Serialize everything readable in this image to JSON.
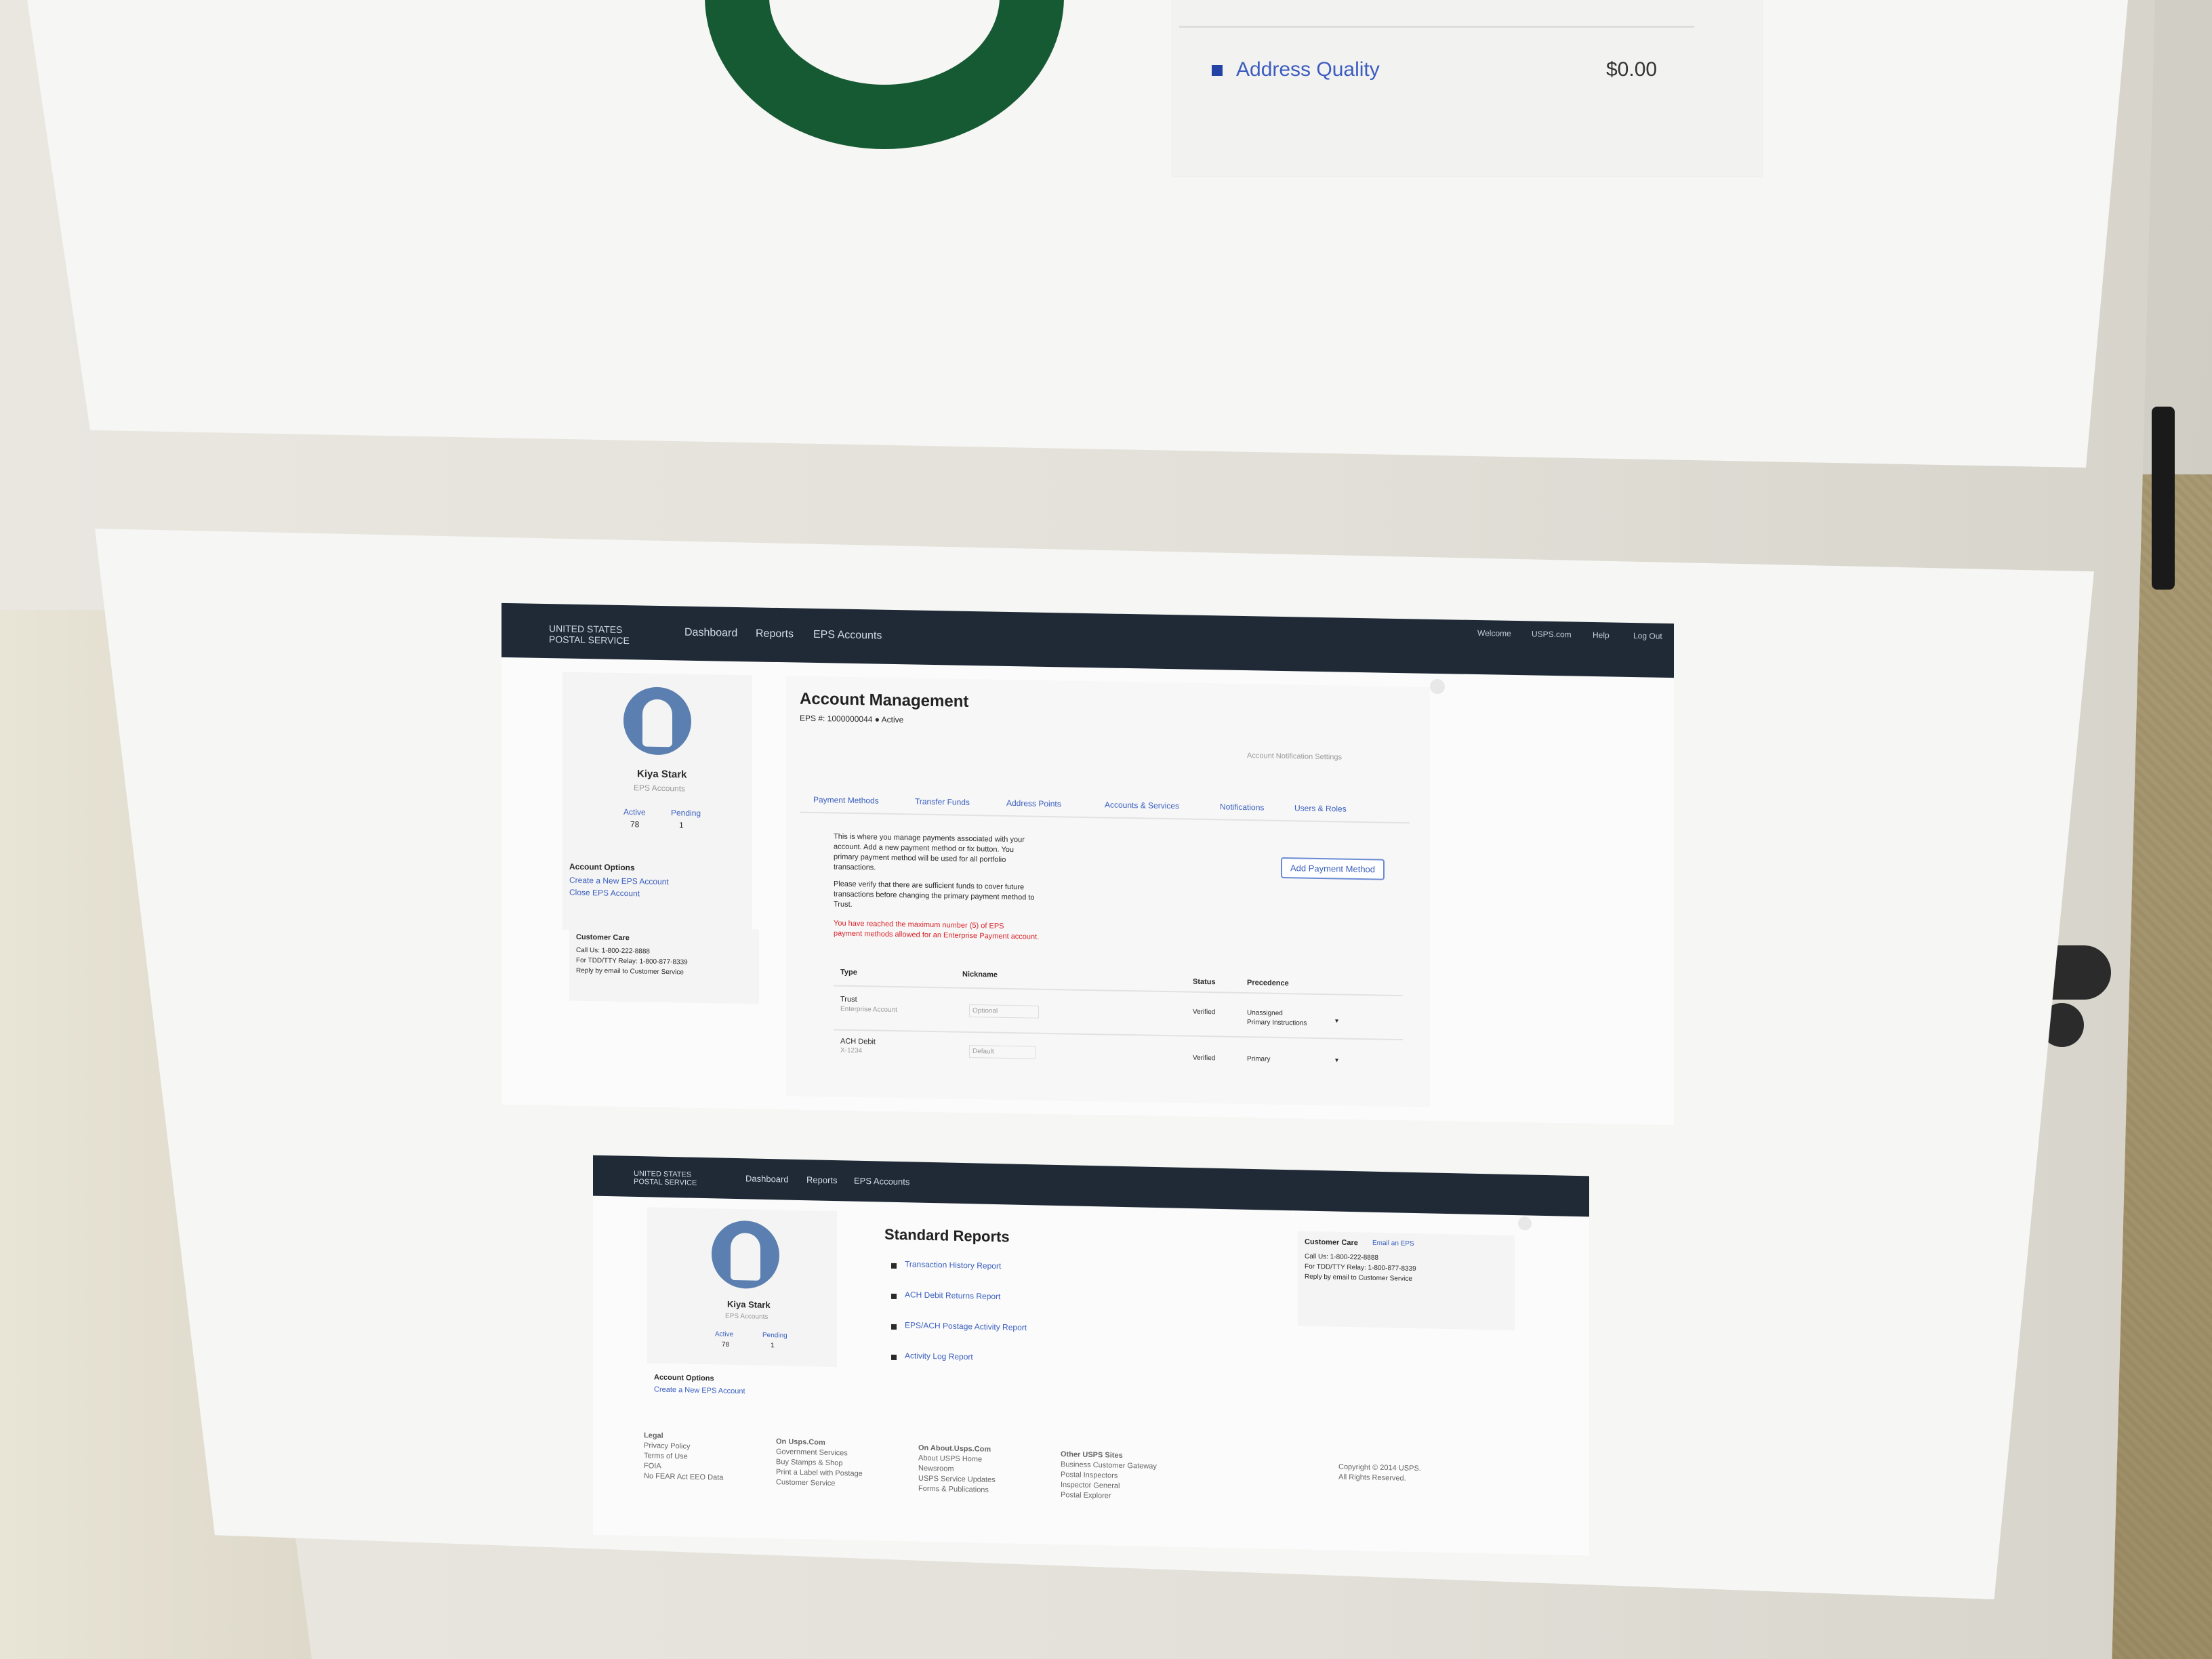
{
  "top_sheet": {
    "legend": [
      {
        "label": "Address Quality",
        "value": "$0.00",
        "color": "#2443a5"
      }
    ],
    "donut_color": "#155a32"
  },
  "printout_account": {
    "nav": {
      "logo": "UNITED STATES POSTAL SERVICE",
      "items": [
        "Dashboard",
        "Reports",
        "EPS Accounts"
      ],
      "right": [
        "Welcome",
        "USPS.com",
        "Help",
        "Log Out"
      ]
    },
    "profile": {
      "name": "Kiya Stark",
      "subtitle": "EPS Accounts",
      "stats": [
        {
          "label": "Active",
          "value": "78"
        },
        {
          "label": "Pending",
          "value": "1"
        }
      ]
    },
    "account_options": {
      "title": "Account Options",
      "links": [
        "Create a New EPS Account",
        "Close EPS Account"
      ]
    },
    "customer_care": {
      "title": "Customer Care",
      "lines": [
        "Call Us: 1-800-222-8888",
        "For TDD/TTY Relay: 1-800-877-8339",
        "Reply by email to Customer Service"
      ]
    },
    "page_title": "Account Management",
    "subline": "EPS #: 1000000044   ● Active",
    "top_right_link": "Account Notification Settings",
    "tabs": [
      "Payment Methods",
      "Transfer Funds",
      "Address Points",
      "Accounts & Services",
      "Notifications",
      "Users & Roles"
    ],
    "intro_lines": [
      "This is where you manage payments associated with your",
      "account. Add a new payment method or fix button. You",
      "primary payment method will be used for all portfolio",
      "transactions.",
      "Please verify that there are sufficient funds to cover future",
      "transactions before changing the primary payment method to",
      "Trust."
    ],
    "warning_lines": [
      "You have reached the maximum number (5) of EPS",
      "payment methods allowed for an Enterprise Payment account."
    ],
    "add_button": "Add Payment Method",
    "table": {
      "headers": [
        "Type",
        "Nickname",
        "Status",
        "Precedence"
      ],
      "rows": [
        {
          "type": "Trust",
          "type_sub": "Enterprise Account",
          "nickname": "Optional",
          "status": "Verified",
          "precedence": "Unassigned",
          "precedence_sub": "Primary Instructions"
        },
        {
          "type": "ACH Debit",
          "type_sub": "X-1234",
          "nickname": "Default",
          "status": "Verified",
          "precedence": "Primary",
          "precedence_sub": ""
        }
      ]
    }
  },
  "printout_reports": {
    "nav": {
      "logo": "UNITED STATES POSTAL SERVICE",
      "items": [
        "Dashboard",
        "Reports",
        "EPS Accounts"
      ]
    },
    "profile": {
      "name": "Kiya Stark",
      "subtitle": "EPS Accounts",
      "stats": [
        {
          "label": "Active",
          "value": "78"
        },
        {
          "label": "Pending",
          "value": "1"
        }
      ]
    },
    "account_options": {
      "title": "Account Options",
      "links": [
        "Create a New EPS Account"
      ]
    },
    "page_title": "Standard Reports",
    "reports": [
      "Transaction History Report",
      "ACH Debit Returns Report",
      "EPS/ACH Postage Activity Report",
      "Activity Log Report"
    ],
    "customer_care": {
      "title": "Customer Care",
      "link": "Email an EPS",
      "lines": [
        "Call Us: 1-800-222-8888",
        "For TDD/TTY Relay: 1-800-877-8339",
        "Reply by email to Customer Service"
      ]
    },
    "footer": {
      "columns": [
        {
          "title": "Legal",
          "items": [
            "Privacy Policy",
            "Terms of Use",
            "FOIA",
            "No FEAR Act EEO Data"
          ]
        },
        {
          "title": "On Usps.Com",
          "items": [
            "Government Services",
            "Buy Stamps & Shop",
            "Print a Label with Postage",
            "Customer Service"
          ]
        },
        {
          "title": "On About.Usps.Com",
          "items": [
            "About USPS Home",
            "Newsroom",
            "USPS Service Updates",
            "Forms & Publications"
          ]
        },
        {
          "title": "Other USPS Sites",
          "items": [
            "Business Customer Gateway",
            "Postal Inspectors",
            "Inspector General",
            "Postal Explorer"
          ]
        }
      ],
      "copyright": [
        "Copyright © 2014 USPS.",
        "All Rights Reserved."
      ]
    }
  }
}
